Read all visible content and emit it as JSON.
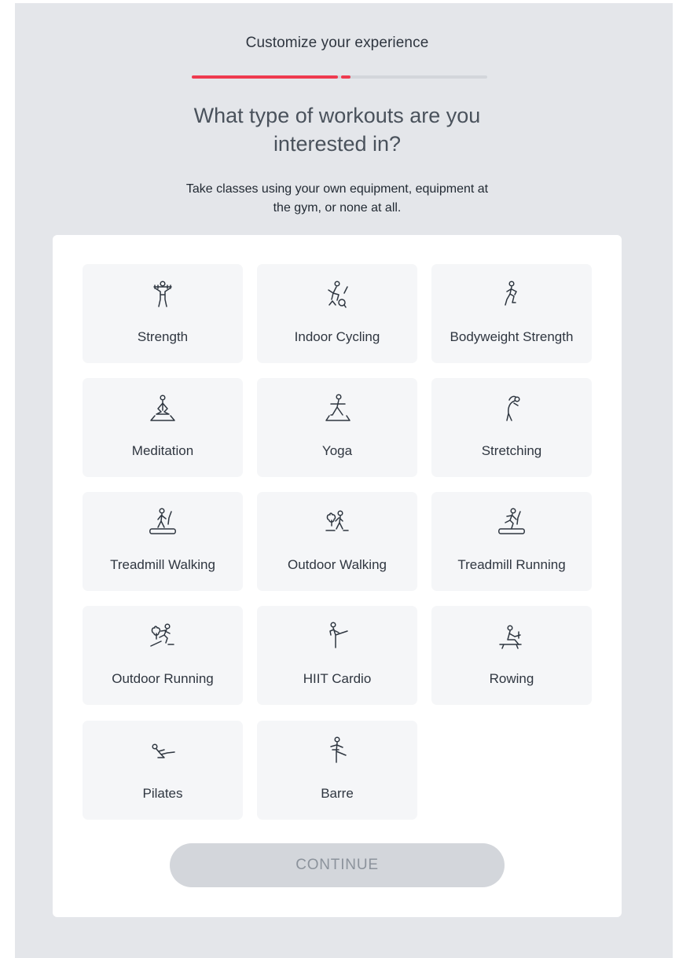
{
  "header": {
    "title": "Customize your experience",
    "progress": {
      "completed_steps": 2,
      "accent_color": "#ee3a4f"
    }
  },
  "question": {
    "line1": "What type of workouts are you",
    "line2": "interested in?"
  },
  "subtitle": {
    "line1": "Take classes using your own equipment, equipment at",
    "line2": "the gym, or none at all."
  },
  "workouts": [
    {
      "label": "Strength",
      "icon": "strength-icon"
    },
    {
      "label": "Indoor Cycling",
      "icon": "indoor-cycling-icon"
    },
    {
      "label": "Bodyweight Strength",
      "icon": "bodyweight-strength-icon"
    },
    {
      "label": "Meditation",
      "icon": "meditation-icon"
    },
    {
      "label": "Yoga",
      "icon": "yoga-icon"
    },
    {
      "label": "Stretching",
      "icon": "stretching-icon"
    },
    {
      "label": "Treadmill Walking",
      "icon": "treadmill-walking-icon"
    },
    {
      "label": "Outdoor Walking",
      "icon": "outdoor-walking-icon"
    },
    {
      "label": "Treadmill Running",
      "icon": "treadmill-running-icon"
    },
    {
      "label": "Outdoor Running",
      "icon": "outdoor-running-icon"
    },
    {
      "label": "HIIT Cardio",
      "icon": "hiit-cardio-icon"
    },
    {
      "label": "Rowing",
      "icon": "rowing-icon"
    },
    {
      "label": "Pilates",
      "icon": "pilates-icon"
    },
    {
      "label": "Barre",
      "icon": "barre-icon"
    }
  ],
  "continue_button": {
    "label": "CONTINUE",
    "enabled": false
  }
}
